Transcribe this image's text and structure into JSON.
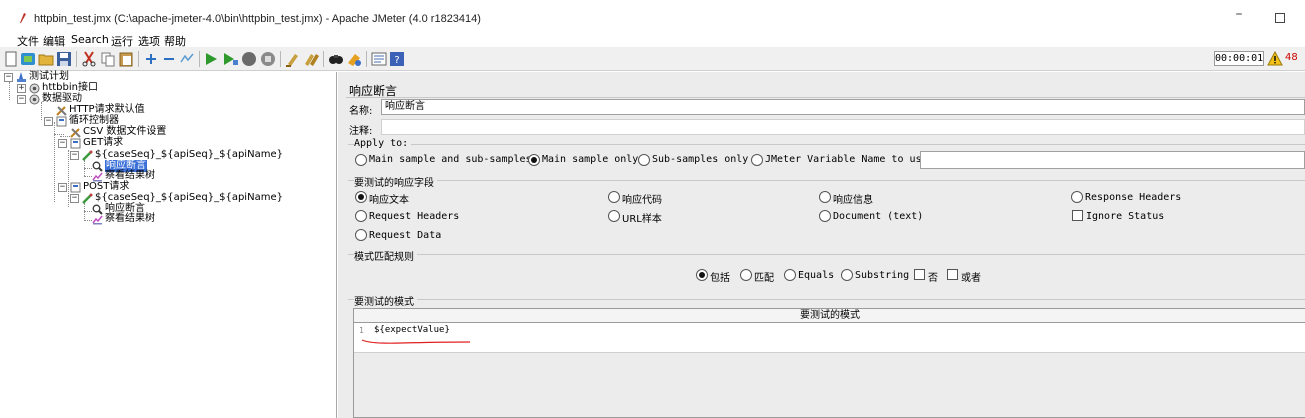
{
  "window": {
    "title": "httpbin_test.jmx (C:\\apache-jmeter-4.0\\bin\\httpbin_test.jmx) - Apache JMeter (4.0 r1823414)",
    "minimize": "–"
  },
  "menu": [
    "文件",
    "编辑",
    "Search",
    "运行",
    "选项",
    "帮助"
  ],
  "toolbar": {
    "timer": "00:00:01",
    "warning_count": "48",
    "icons": [
      "new-icon",
      "templates-icon",
      "open-icon",
      "save-icon",
      "cut-icon",
      "copy-icon",
      "paste-icon",
      "expand-icon",
      "collapse-icon",
      "toggle-icon",
      "start-icon",
      "start-no-pause-icon",
      "stop-icon",
      "shutdown-icon",
      "clear-icon",
      "clear-all-icon",
      "search-icon",
      "reset-search-icon",
      "function-helper-icon",
      "help-icon"
    ]
  },
  "tree": {
    "nodes": [
      {
        "label": "测试计划",
        "icon": "test-plan-icon"
      },
      {
        "label": "httbbin接口",
        "icon": "thread-group-icon"
      },
      {
        "label": "数据驱动",
        "icon": "thread-group-icon"
      },
      {
        "label": "HTTP请求默认值",
        "icon": "config-icon"
      },
      {
        "label": "循环控制器",
        "icon": "controller-icon"
      },
      {
        "label": "CSV 数据文件设置",
        "icon": "config-icon"
      },
      {
        "label": "GET请求",
        "icon": "controller-icon"
      },
      {
        "label": "${caseSeq}_${apiSeq}_${apiName}",
        "icon": "sampler-icon"
      },
      {
        "label": "响应断言",
        "icon": "assertion-icon"
      },
      {
        "label": "察看结果树",
        "icon": "listener-icon"
      },
      {
        "label": "POST请求",
        "icon": "controller-icon"
      },
      {
        "label": "${caseSeq}_${apiSeq}_${apiName}",
        "icon": "sampler-icon"
      },
      {
        "label": "响应断言",
        "icon": "assertion-icon"
      },
      {
        "label": "察看结果树",
        "icon": "listener-icon"
      }
    ]
  },
  "panel": {
    "title": "响应断言",
    "name_label": "名称:",
    "name_value": "响应断言",
    "comment_label": "注释:",
    "comment_value": "",
    "apply_to": {
      "title": "Apply to:",
      "options": [
        "Main sample and sub-samples",
        "Main sample only",
        "Sub-samples only",
        "JMeter Variable Name to use"
      ],
      "selected": "Main sample only",
      "variable_name": ""
    },
    "field_to_test": {
      "title": "要测试的响应字段",
      "options": [
        "响应文本",
        "响应代码",
        "响应信息",
        "Response Headers",
        "Request Headers",
        "URL样本",
        "Document (text)",
        "Request Data"
      ],
      "selected": "响应文本",
      "ignore_status_label": "Ignore Status",
      "ignore_status": false
    },
    "matching_rules": {
      "title": "模式匹配规则",
      "options": [
        "包括",
        "匹配",
        "Equals",
        "Substring"
      ],
      "selected": "包括",
      "not_label": "否",
      "or_label": "或者"
    },
    "patterns": {
      "title": "要测试的模式",
      "column_header": "要测试的模式",
      "rows": [
        {
          "line": "1",
          "value": "${expectValue}"
        }
      ]
    }
  }
}
